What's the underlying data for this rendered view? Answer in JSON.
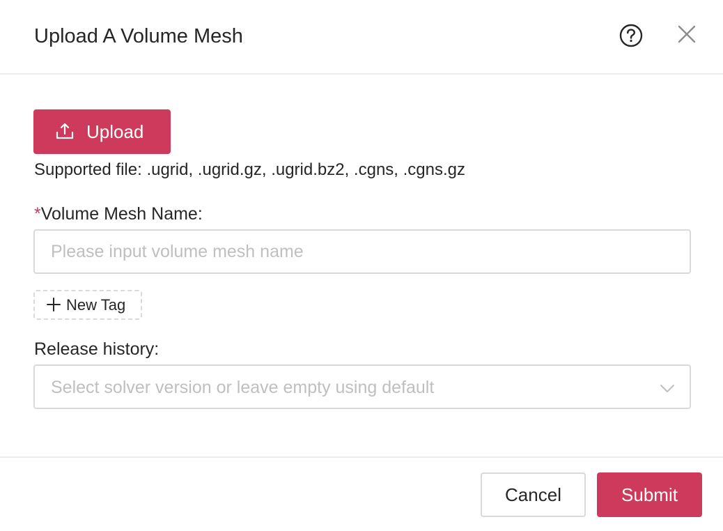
{
  "modal": {
    "title": "Upload A Volume Mesh",
    "help_icon": "question-circle-icon",
    "close_icon": "close-icon"
  },
  "upload": {
    "button_label": "Upload",
    "icon": "upload-icon",
    "supported_text": "Supported file: .ugrid, .ugrid.gz, .ugrid.bz2, .cgns, .cgns.gz"
  },
  "mesh_name": {
    "required_marker": "*",
    "label": "Volume Mesh Name:",
    "value": "",
    "placeholder": "Please input volume mesh name"
  },
  "tag": {
    "button_label": "New Tag",
    "icon": "plus-icon"
  },
  "release_history": {
    "label": "Release history:",
    "placeholder": "Select solver version or leave empty using default",
    "icon": "chevron-down-icon"
  },
  "footer": {
    "cancel_label": "Cancel",
    "submit_label": "Submit"
  },
  "colors": {
    "primary": "#cd3a5b",
    "border": "#d9d9d9",
    "placeholder": "#bfbfbf",
    "text": "#262626"
  }
}
